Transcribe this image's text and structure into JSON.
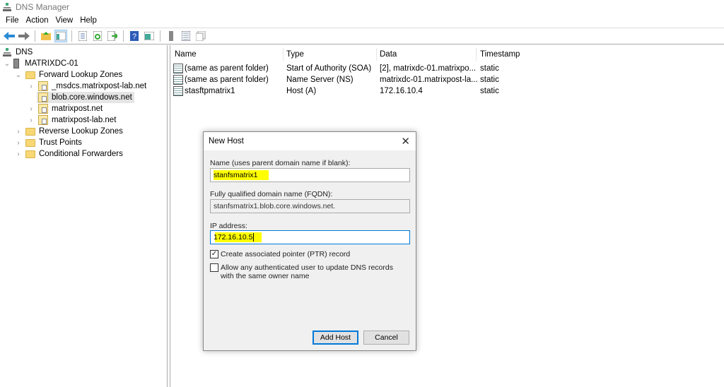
{
  "window": {
    "title": "DNS Manager"
  },
  "menu": [
    "File",
    "Action",
    "View",
    "Help"
  ],
  "tree": {
    "root": "DNS",
    "server": "MATRIXDC-01",
    "forward": "Forward Lookup Zones",
    "zones": [
      "_msdcs.matrixpost-lab.net",
      "blob.core.windows.net",
      "matrixpost.net",
      "matrixpost-lab.net"
    ],
    "reverse": "Reverse Lookup Zones",
    "trust": "Trust Points",
    "conditional": "Conditional Forwarders"
  },
  "list": {
    "columns": [
      "Name",
      "Type",
      "Data",
      "Timestamp"
    ],
    "rows": [
      {
        "name": "(same as parent folder)",
        "type": "Start of Authority (SOA)",
        "data": "[2], matrixdc-01.matrixpo...",
        "timestamp": "static"
      },
      {
        "name": "(same as parent folder)",
        "type": "Name Server (NS)",
        "data": "matrixdc-01.matrixpost-la...",
        "timestamp": "static"
      },
      {
        "name": "stasftpmatrix1",
        "type": "Host (A)",
        "data": "172.16.10.4",
        "timestamp": "static"
      }
    ]
  },
  "dialog": {
    "title": "New Host",
    "close": "✕",
    "name_label": "Name (uses parent domain name if blank):",
    "name_value": "stanfsmatrix1",
    "fqdn_label": "Fully qualified domain name (FQDN):",
    "fqdn_value": "stanfsmatrix1.blob.core.windows.net.",
    "ip_label": "IP address:",
    "ip_value": "172.16.10.5",
    "ptr_label": "Create associated pointer (PTR) record",
    "ptr_checked": true,
    "allow_label": "Allow any authenticated user to update DNS records with the same owner name",
    "allow_checked": false,
    "add_button": "Add Host",
    "cancel_button": "Cancel"
  }
}
